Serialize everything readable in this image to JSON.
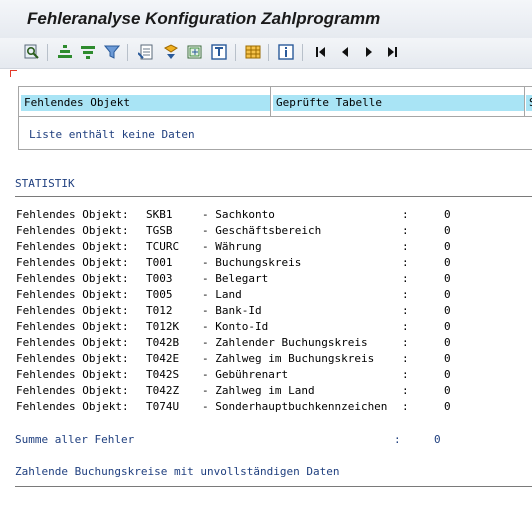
{
  "window": {
    "title": "Fehleranalyse Konfiguration Zahlprogramm"
  },
  "toolbar": {
    "icons": [
      "find-icon",
      "align-center-icon",
      "filter-icon",
      "filter-edit-icon",
      "export-icon",
      "sort-icon",
      "spreadsheet-icon",
      "print-icon",
      "layout-grid-icon",
      "info-icon",
      "first-page-icon",
      "previous-page-icon",
      "next-page-icon",
      "last-page-icon"
    ]
  },
  "grid": {
    "columns": [
      "Fehlendes Objekt",
      "Geprüfte Tabelle",
      "S"
    ],
    "empty_message": "Liste enthält keine Daten"
  },
  "statistik": {
    "heading": "STATISTIK",
    "rows": [
      {
        "label": "Fehlendes Objekt:",
        "code": "SKB1",
        "desc": "- Sachkonto",
        "sep": ":",
        "value": "0"
      },
      {
        "label": "Fehlendes Objekt:",
        "code": "TGSB",
        "desc": "- Geschäftsbereich",
        "sep": ":",
        "value": "0"
      },
      {
        "label": "Fehlendes Objekt:",
        "code": "TCURC",
        "desc": "- Währung",
        "sep": ":",
        "value": "0"
      },
      {
        "label": "Fehlendes Objekt:",
        "code": "T001",
        "desc": "- Buchungskreis",
        "sep": ":",
        "value": "0"
      },
      {
        "label": "Fehlendes Objekt:",
        "code": "T003",
        "desc": "- Belegart",
        "sep": ":",
        "value": "0"
      },
      {
        "label": "Fehlendes Objekt:",
        "code": "T005",
        "desc": "- Land",
        "sep": ":",
        "value": "0"
      },
      {
        "label": "Fehlendes Objekt:",
        "code": "T012",
        "desc": "- Bank-Id",
        "sep": ":",
        "value": "0"
      },
      {
        "label": "Fehlendes Objekt:",
        "code": "T012K",
        "desc": "- Konto-Id",
        "sep": ":",
        "value": "0"
      },
      {
        "label": "Fehlendes Objekt:",
        "code": "T042B",
        "desc": "- Zahlender Buchungskreis",
        "sep": ":",
        "value": "0"
      },
      {
        "label": "Fehlendes Objekt:",
        "code": "T042E",
        "desc": "- Zahlweg im Buchungskreis",
        "sep": ":",
        "value": "0"
      },
      {
        "label": "Fehlendes Objekt:",
        "code": "T042S",
        "desc": "- Gebührenart",
        "sep": ":",
        "value": "0"
      },
      {
        "label": "Fehlendes Objekt:",
        "code": "T042Z",
        "desc": "- Zahlweg im Land",
        "sep": ":",
        "value": "0"
      },
      {
        "label": "Fehlendes Objekt:",
        "code": "T074U",
        "desc": "- Sonderhauptbuchkennzeichen",
        "sep": ":",
        "value": "0"
      }
    ],
    "summary": {
      "label": "Summe aller Fehler",
      "sep": ":",
      "value": "0"
    },
    "footer": "Zahlende Buchungskreise mit unvollständigen Daten"
  }
}
